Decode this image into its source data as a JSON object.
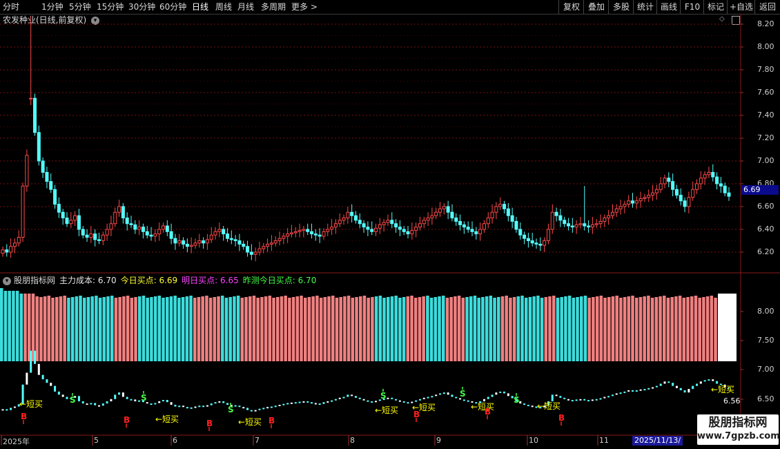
{
  "toolbar": {
    "periods": [
      "分时",
      "1分钟",
      "5分钟",
      "15分钟",
      "30分钟",
      "60分钟",
      "日线",
      "周线",
      "月线",
      "多周期",
      "更多 >"
    ],
    "active_period": "日线",
    "right_buttons": [
      "复权",
      "叠加",
      "多股",
      "统计",
      "画线",
      "F10",
      "标记",
      "+自选",
      "返回"
    ]
  },
  "chart_title": "农发种业(日线,前复权)",
  "indicator": {
    "name": "股朋指标网",
    "main_cost_label": "主力成本: 6.70",
    "today_buy_label": "今日买点: 6.69",
    "tomorrow_buy_label": "明日买点: 6.65",
    "yesterday_buy_label": "昨测今日买点: 6.70"
  },
  "colors": {
    "up": "#ff4a4a",
    "down": "#54ffff",
    "bar_up": "#f08080",
    "bar_down": "#3cdcdc",
    "grid": "#7a1010",
    "buy_label": "#ffff00",
    "magenta": "#ff44ff",
    "green": "#44ff44",
    "sell_marker": "#ff2020"
  },
  "axis": {
    "main_ticks": [
      "8.20",
      "8.00",
      "7.80",
      "7.60",
      "7.40",
      "7.20",
      "7.00",
      "6.80",
      "6.60",
      "6.40",
      "6.20"
    ],
    "current_price": "6.69",
    "ind_ticks_upper": [
      "8.00",
      "7.50"
    ],
    "ind_ticks_lower": [
      "7.00",
      "6.50"
    ],
    "ind_value": "6.56",
    "dates": [
      "2025年",
      "5",
      "6",
      "7",
      "8",
      "9",
      "10",
      "11"
    ],
    "cursor_date": "2025/11/13/"
  },
  "signals": {
    "short_buy_text": "←短买",
    "buy_marker": "B",
    "sell_marker": "S"
  },
  "watermark": {
    "line1": "股朋指标网",
    "line2": "www.7gpzb.com"
  },
  "chart_data": {
    "type": "candlestick",
    "y_range_main": [
      6.1,
      8.25
    ],
    "close_series": [
      6.22,
      6.2,
      6.25,
      6.28,
      6.33,
      6.78,
      7.05,
      7.55,
      7.25,
      7.0,
      6.9,
      6.82,
      6.75,
      6.62,
      6.55,
      6.5,
      6.45,
      6.48,
      6.52,
      6.4,
      6.35,
      6.33,
      6.36,
      6.31,
      6.3,
      6.35,
      6.4,
      6.45,
      6.55,
      6.6,
      6.5,
      6.45,
      6.44,
      6.4,
      6.42,
      6.38,
      6.35,
      6.34,
      6.36,
      6.4,
      6.43,
      6.38,
      6.32,
      6.28,
      6.3,
      6.27,
      6.25,
      6.26,
      6.28,
      6.3,
      6.28,
      6.31,
      6.35,
      6.38,
      6.4,
      6.36,
      6.32,
      6.31,
      6.3,
      6.27,
      6.25,
      6.2,
      6.18,
      6.2,
      6.23,
      6.25,
      6.27,
      6.28,
      6.3,
      6.32,
      6.34,
      6.36,
      6.37,
      6.38,
      6.39,
      6.4,
      6.38,
      6.36,
      6.35,
      6.34,
      6.38,
      6.4,
      6.42,
      6.45,
      6.48,
      6.5,
      6.55,
      6.52,
      6.48,
      6.45,
      6.42,
      6.4,
      6.38,
      6.41,
      6.44,
      6.46,
      6.48,
      6.45,
      6.42,
      6.4,
      6.38,
      6.36,
      6.39,
      6.42,
      6.45,
      6.48,
      6.5,
      6.52,
      6.55,
      6.58,
      6.6,
      6.55,
      6.5,
      6.47,
      6.44,
      6.42,
      6.4,
      6.38,
      6.36,
      6.4,
      6.45,
      6.5,
      6.55,
      6.6,
      6.62,
      6.58,
      6.52,
      6.47,
      6.4,
      6.35,
      6.32,
      6.3,
      6.28,
      6.27,
      6.26,
      6.3,
      6.4,
      6.55,
      6.52,
      6.48,
      6.45,
      6.43,
      6.42,
      6.44,
      6.45,
      6.43,
      6.42,
      6.44,
      6.45,
      6.47,
      6.5,
      6.52,
      6.55,
      6.58,
      6.6,
      6.62,
      6.65,
      6.63,
      6.65,
      6.67,
      6.68,
      6.7,
      6.72,
      6.75,
      6.8,
      6.85,
      6.82,
      6.75,
      6.7,
      6.65,
      6.6,
      6.68,
      6.75,
      6.8,
      6.85,
      6.88,
      6.9,
      6.86,
      6.8,
      6.78,
      6.72,
      6.69
    ],
    "indicator_bars_range": [
      7.1,
      8.5
    ]
  }
}
